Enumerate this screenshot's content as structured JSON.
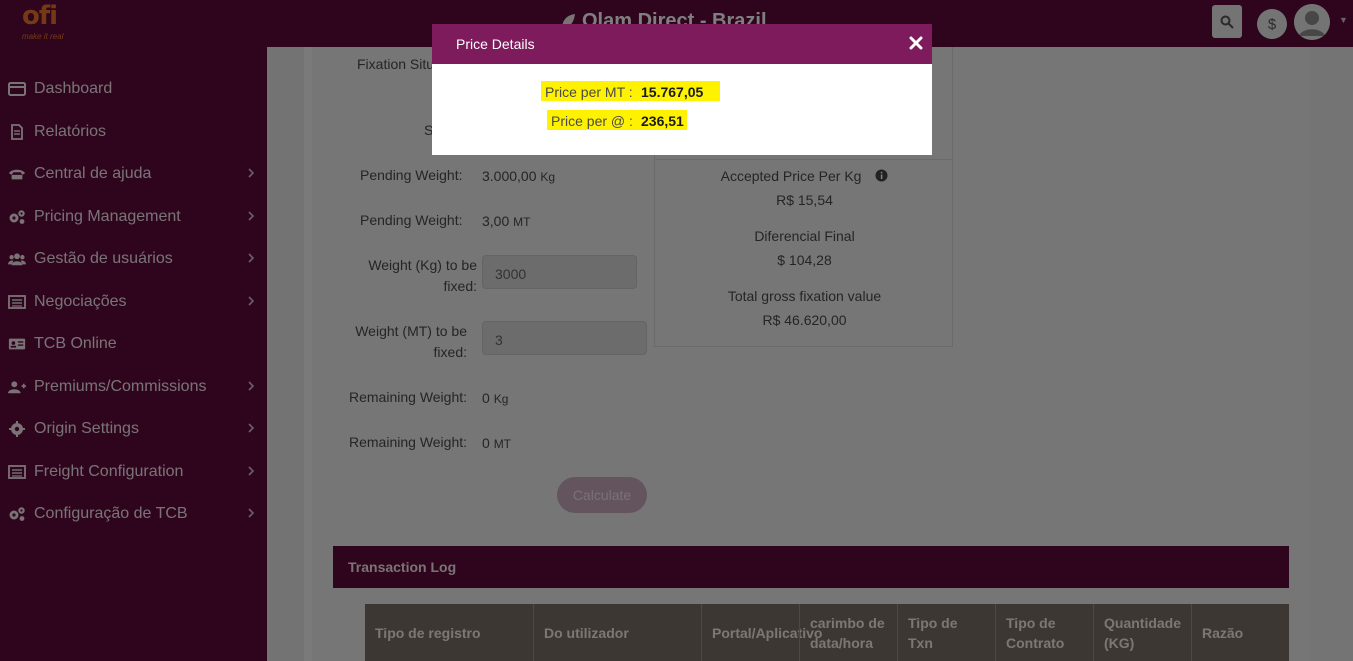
{
  "header": {
    "logo_text": "ofi",
    "logo_tagline": "make it real",
    "app_title": "Olam Direct - Brazil",
    "currency_symbol": "$"
  },
  "sidebar": {
    "items": [
      {
        "label": "Dashboard",
        "icon": "card-icon",
        "has_submenu": false
      },
      {
        "label": "Relatórios",
        "icon": "document-icon",
        "has_submenu": false
      },
      {
        "label": "Central de ajuda",
        "icon": "phone-icon",
        "has_submenu": true
      },
      {
        "label": "Pricing Management",
        "icon": "gears-icon",
        "has_submenu": true
      },
      {
        "label": "Gestão de usuários",
        "icon": "users-icon",
        "has_submenu": true
      },
      {
        "label": "Negociações",
        "icon": "list-icon",
        "has_submenu": true
      },
      {
        "label": "TCB Online",
        "icon": "id-card-icon",
        "has_submenu": false
      },
      {
        "label": "Premiums/Commissions",
        "icon": "user-plus-icon",
        "has_submenu": true
      },
      {
        "label": "Origin Settings",
        "icon": "gear-icon",
        "has_submenu": true
      },
      {
        "label": "Freight Configuration",
        "icon": "list-icon",
        "has_submenu": true
      },
      {
        "label": "Configuração de TCB",
        "icon": "gears-icon",
        "has_submenu": true
      }
    ]
  },
  "form": {
    "fixation_situation_label": "Fixation Situ",
    "partial_label_s": "S",
    "pending_weight_kg_label": "Pending Weight:",
    "pending_weight_kg_value": "3.000,00",
    "pending_weight_kg_unit": "Kg",
    "pending_weight_mt_label": "Pending Weight:",
    "pending_weight_mt_value": "3,00",
    "pending_weight_mt_unit": "MT",
    "weight_kg_label_1": "Weight (Kg) to be",
    "weight_kg_label_2": "fixed:",
    "weight_kg_value": "3000",
    "weight_mt_label_1": "Weight (MT) to be",
    "weight_mt_label_2": "fixed:",
    "weight_mt_value": "3",
    "remaining_kg_label": "Remaining Weight:",
    "remaining_kg_value": "0",
    "remaining_kg_unit": "Kg",
    "remaining_mt_label": "Remaining Weight:",
    "remaining_mt_value": "0",
    "remaining_mt_unit": "MT",
    "calculate_button": "Calculate"
  },
  "summary": {
    "accepted_price_label": "Accepted Price Per Kg",
    "accepted_price_value": "R$ 15,54",
    "diferencial_label": "Diferencial Final",
    "diferencial_value": "$ 104,28",
    "total_gross_label": "Total gross fixation value",
    "total_gross_value": "R$ 46.620,00"
  },
  "transaction_log": {
    "title": "Transaction Log",
    "columns": [
      "Tipo de registro",
      "Do utilizador",
      "Portal/Aplicativo",
      "carimbo de data/hora",
      "Tipo de Txn",
      "Tipo de Contrato",
      "Quantidade (KG)",
      "Razão"
    ]
  },
  "modal": {
    "title": "Price Details",
    "price_per_mt_label": "Price per MT :",
    "price_per_mt_value": "15.767,05",
    "price_per_arroba_label": "Price per @ :",
    "price_per_arroba_value": "236,51",
    "highlight_color": "#fff200"
  },
  "colors": {
    "brand_purple": "#5e0a3c",
    "modal_header": "#7d1b5c",
    "logo_orange": "#e8732a"
  }
}
